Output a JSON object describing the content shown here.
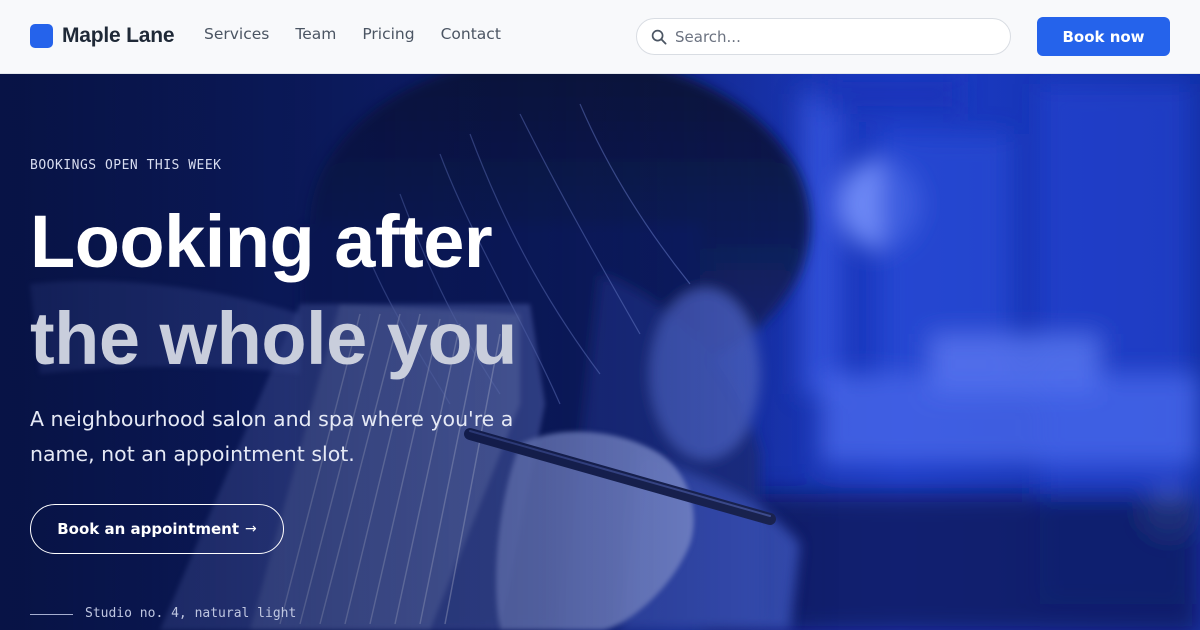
{
  "header": {
    "brand_name": "Maple Lane",
    "nav": [
      "Services",
      "Team",
      "Pricing",
      "Contact"
    ],
    "search_placeholder": "Search...",
    "book_now_label": "Book now"
  },
  "hero": {
    "eyebrow": "BOOKINGS OPEN THIS WEEK",
    "headline_line_1": "Looking after",
    "headline_line_2": "the whole you",
    "subtext": "A neighbourhood salon and spa where you're a name, not an appointment slot.",
    "cta_label": "Book an appointment",
    "cta_icon": "arrow-right-icon",
    "caption": "Studio no. 4, natural light"
  },
  "colors": {
    "accent": "#2563eb",
    "header_bg": "#f8f9fb",
    "photo_tint": "#1d3cc7"
  }
}
